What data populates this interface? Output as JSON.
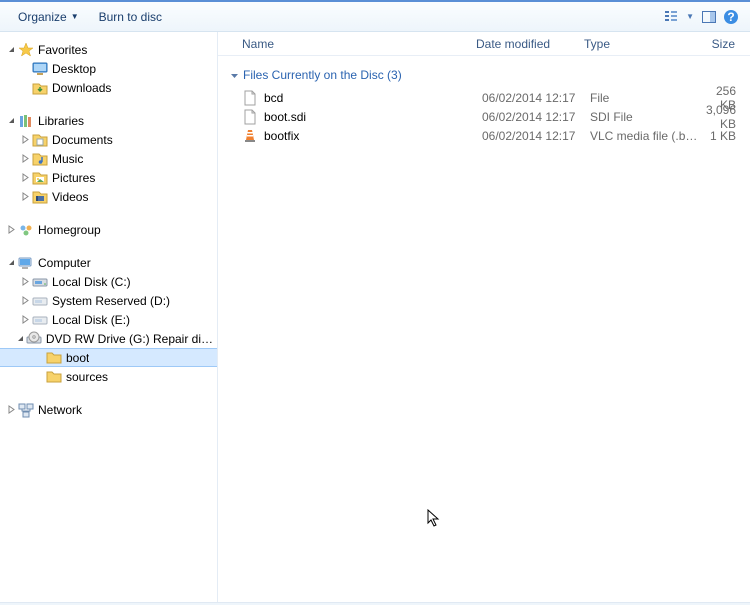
{
  "toolbar": {
    "organize_label": "Organize",
    "burn_label": "Burn to disc"
  },
  "columns": {
    "name": "Name",
    "date": "Date modified",
    "type": "Type",
    "size": "Size"
  },
  "group_header": "Files Currently on the Disc (3)",
  "files": [
    {
      "icon": "file",
      "name": "bcd",
      "date": "06/02/2014 12:17",
      "type": "File",
      "size": "256 KB"
    },
    {
      "icon": "file",
      "name": "boot.sdi",
      "date": "06/02/2014 12:17",
      "type": "SDI File",
      "size": "3,096 KB"
    },
    {
      "icon": "vlc",
      "name": "bootfix",
      "date": "06/02/2014 12:17",
      "type": "VLC media file (.bi...",
      "size": "1 KB"
    }
  ],
  "nav": [
    {
      "type": "group",
      "expanded": true,
      "icon": "star",
      "label": "Favorites",
      "indent": 0,
      "items": [
        {
          "icon": "desktop",
          "label": "Desktop",
          "indent": 1
        },
        {
          "icon": "downloads",
          "label": "Downloads",
          "indent": 1
        }
      ]
    },
    {
      "type": "group",
      "expanded": true,
      "icon": "library",
      "label": "Libraries",
      "indent": 0,
      "items": [
        {
          "arrow": true,
          "icon": "doclib",
          "label": "Documents",
          "indent": 1
        },
        {
          "arrow": true,
          "icon": "musiclib",
          "label": "Music",
          "indent": 1
        },
        {
          "arrow": true,
          "icon": "piclib",
          "label": "Pictures",
          "indent": 1
        },
        {
          "arrow": true,
          "icon": "vidlib",
          "label": "Videos",
          "indent": 1
        }
      ]
    },
    {
      "type": "group",
      "expanded": false,
      "icon": "homegroup",
      "label": "Homegroup",
      "indent": 0,
      "items": []
    },
    {
      "type": "group",
      "expanded": true,
      "icon": "computer",
      "label": "Computer",
      "indent": 0,
      "items": [
        {
          "arrow": true,
          "icon": "drive",
          "label": "Local Disk (C:)",
          "indent": 1
        },
        {
          "arrow": true,
          "icon": "drive-light",
          "label": "System Reserved (D:)",
          "indent": 1
        },
        {
          "arrow": true,
          "icon": "drive-light",
          "label": "Local Disk (E:)",
          "indent": 1
        },
        {
          "arrow": true,
          "expanded": true,
          "icon": "dvd",
          "label": "DVD RW Drive (G:) Repair disc Windows",
          "indent": 1,
          "items": [
            {
              "icon": "folder",
              "label": "boot",
              "indent": 2,
              "selected": true
            },
            {
              "icon": "folder",
              "label": "sources",
              "indent": 2
            }
          ]
        }
      ]
    },
    {
      "type": "group",
      "expanded": false,
      "icon": "network",
      "label": "Network",
      "indent": 0,
      "items": []
    }
  ]
}
